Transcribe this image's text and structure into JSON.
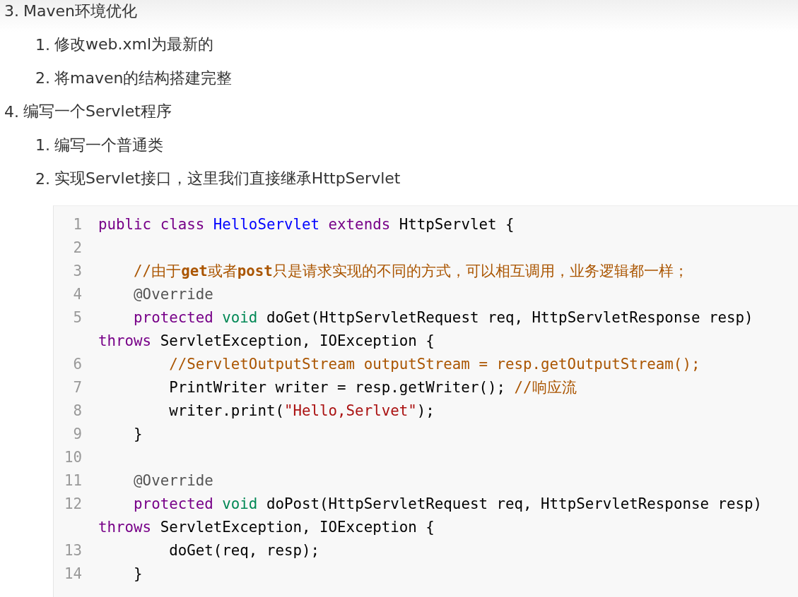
{
  "outline": [
    {
      "number": "3.",
      "text": "Maven环境优化",
      "children": [
        {
          "number": "1.",
          "text": "修改web.xml为最新的"
        },
        {
          "number": "2.",
          "text": "将maven的结构搭建完整"
        }
      ]
    },
    {
      "number": "4.",
      "text": "编写一个Servlet程序",
      "children": [
        {
          "number": "1.",
          "text": "编写一个普通类"
        },
        {
          "number": "2.",
          "text": "实现Servlet接口，这里我们直接继承HttpServlet"
        }
      ]
    }
  ],
  "code_block": {
    "lines": [
      {
        "number": "1",
        "tokens": [
          {
            "kind": "keyword",
            "text": "public "
          },
          {
            "kind": "keyword",
            "text": "class "
          },
          {
            "kind": "def",
            "text": "HelloServlet "
          },
          {
            "kind": "keyword",
            "text": "extends "
          },
          {
            "kind": "plain",
            "text": "HttpServlet {"
          }
        ]
      },
      {
        "number": "2"
      },
      {
        "number": "3",
        "tokens": [
          {
            "kind": "comment",
            "text": "    //由于**get**或者**post**只是请求实现的不同的方式，可以相互调用，业务逻辑都一样；"
          }
        ]
      },
      {
        "number": "4",
        "tokens": [
          {
            "kind": "meta",
            "text": "    @Override"
          }
        ]
      },
      {
        "number": "5",
        "tokens": [
          {
            "kind": "keyword",
            "text": "    protected "
          },
          {
            "kind": "type",
            "text": "void "
          },
          {
            "kind": "plain",
            "text": "doGet(HttpServletRequest req, HttpServletResponse resp) "
          },
          {
            "kind": "keyword",
            "text": "throws "
          },
          {
            "kind": "plain",
            "text": "ServletException, IOException {"
          }
        ]
      },
      {
        "number": "6",
        "tokens": [
          {
            "kind": "comment",
            "text": "        //ServletOutputStream outputStream = resp.getOutputStream();"
          }
        ]
      },
      {
        "number": "7",
        "tokens": [
          {
            "kind": "plain",
            "text": "        PrintWriter writer = resp.getWriter(); "
          },
          {
            "kind": "comment",
            "text": "//响应流"
          }
        ]
      },
      {
        "number": "8",
        "tokens": [
          {
            "kind": "plain",
            "text": "        writer.print("
          },
          {
            "kind": "string",
            "text": "\"Hello,Serlvet\""
          },
          {
            "kind": "plain",
            "text": ");"
          }
        ]
      },
      {
        "number": "9",
        "tokens": [
          {
            "kind": "plain",
            "text": "    }"
          }
        ]
      },
      {
        "number": "10"
      },
      {
        "number": "11",
        "tokens": [
          {
            "kind": "meta",
            "text": "    @Override"
          }
        ]
      },
      {
        "number": "12",
        "tokens": [
          {
            "kind": "keyword",
            "text": "    protected "
          },
          {
            "kind": "type",
            "text": "void "
          },
          {
            "kind": "plain",
            "text": "doPost(HttpServletRequest req, HttpServletResponse resp) "
          },
          {
            "kind": "keyword",
            "text": "throws "
          },
          {
            "kind": "plain",
            "text": "ServletException, IOException {"
          }
        ]
      },
      {
        "number": "13",
        "tokens": [
          {
            "kind": "plain",
            "text": "        doGet(req, resp);"
          }
        ]
      },
      {
        "number": "14",
        "tokens": [
          {
            "kind": "plain",
            "text": "    }"
          }
        ]
      }
    ]
  }
}
